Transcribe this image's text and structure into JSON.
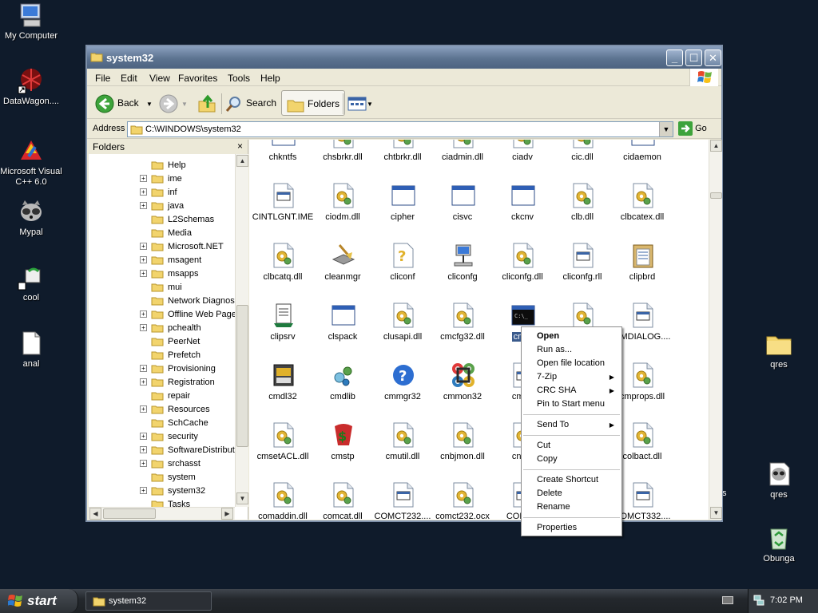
{
  "desktop": {
    "left_icons": [
      {
        "label": "My Computer",
        "icon": "my-computer-icon"
      },
      {
        "label": "DataWagon....",
        "icon": "datawagon-shortcut-icon"
      },
      {
        "label": "Microsoft Visual C++ 6.0",
        "icon": "visual-cpp-icon"
      },
      {
        "label": "Mypal",
        "icon": "mypal-browser-icon"
      },
      {
        "label": "cool",
        "icon": "cool-shortcut-icon"
      },
      {
        "label": "anal",
        "icon": "document-icon"
      }
    ],
    "right_icons": [
      {
        "label": "qres",
        "icon": "folder-icon"
      },
      {
        "label": "qres",
        "icon": "raccoon-app-icon"
      },
      {
        "label": "Obunga",
        "icon": "recycle-bin-icon"
      }
    ],
    "partial_label": "s"
  },
  "window": {
    "title": "system32",
    "menu": [
      "File",
      "Edit",
      "View",
      "Favorites",
      "Tools",
      "Help"
    ],
    "toolbar": {
      "back_label": "Back",
      "search_label": "Search",
      "folders_label": "Folders"
    },
    "address": {
      "label": "Address",
      "value": "C:\\WINDOWS\\system32",
      "go_label": "Go"
    }
  },
  "folders_pane": {
    "title": "Folders",
    "close_glyph": "×",
    "tree": [
      {
        "name": "Help",
        "expandable": false
      },
      {
        "name": "ime",
        "expandable": true
      },
      {
        "name": "inf",
        "expandable": true
      },
      {
        "name": "java",
        "expandable": true
      },
      {
        "name": "L2Schemas",
        "expandable": false
      },
      {
        "name": "Media",
        "expandable": false
      },
      {
        "name": "Microsoft.NET",
        "expandable": true
      },
      {
        "name": "msagent",
        "expandable": true
      },
      {
        "name": "msapps",
        "expandable": true
      },
      {
        "name": "mui",
        "expandable": false
      },
      {
        "name": "Network Diagnost",
        "expandable": false
      },
      {
        "name": "Offline Web Page",
        "expandable": true
      },
      {
        "name": "pchealth",
        "expandable": true
      },
      {
        "name": "PeerNet",
        "expandable": false
      },
      {
        "name": "Prefetch",
        "expandable": false
      },
      {
        "name": "Provisioning",
        "expandable": true
      },
      {
        "name": "Registration",
        "expandable": true
      },
      {
        "name": "repair",
        "expandable": false
      },
      {
        "name": "Resources",
        "expandable": true
      },
      {
        "name": "SchCache",
        "expandable": false
      },
      {
        "name": "security",
        "expandable": true
      },
      {
        "name": "SoftwareDistribut",
        "expandable": true
      },
      {
        "name": "srchasst",
        "expandable": true
      },
      {
        "name": "system",
        "expandable": false
      },
      {
        "name": "system32",
        "expandable": true
      },
      {
        "name": "Tasks",
        "expandable": false
      }
    ]
  },
  "files": [
    {
      "name": "chkntfs",
      "icon": "console-app-icon"
    },
    {
      "name": "chsbrkr.dll",
      "icon": "dll-gear-icon"
    },
    {
      "name": "chtbrkr.dll",
      "icon": "dll-gear-icon"
    },
    {
      "name": "ciadmin.dll",
      "icon": "dll-gear-icon"
    },
    {
      "name": "ciadv",
      "icon": "dll-gear-icon"
    },
    {
      "name": "cic.dll",
      "icon": "dll-gear-icon"
    },
    {
      "name": "cidaemon",
      "icon": "console-app-icon"
    },
    {
      "name": "CINTLGNT.IME",
      "icon": "sys-file-icon"
    },
    {
      "name": "ciodm.dll",
      "icon": "dll-gear-icon"
    },
    {
      "name": "cipher",
      "icon": "window-app-icon"
    },
    {
      "name": "cisvc",
      "icon": "window-app-icon"
    },
    {
      "name": "ckcnv",
      "icon": "window-app-icon"
    },
    {
      "name": "clb.dll",
      "icon": "dll-gear-icon"
    },
    {
      "name": "clbcatex.dll",
      "icon": "dll-gear-icon"
    },
    {
      "name": "clbcatq.dll",
      "icon": "dll-gear-icon"
    },
    {
      "name": "cleanmgr",
      "icon": "disk-cleanup-icon"
    },
    {
      "name": "cliconf",
      "icon": "help-file-icon"
    },
    {
      "name": "cliconfg",
      "icon": "network-computer-icon"
    },
    {
      "name": "cliconfg.dll",
      "icon": "dll-gear-icon"
    },
    {
      "name": "cliconfg.rll",
      "icon": "sys-file-icon"
    },
    {
      "name": "clipbrd",
      "icon": "clipboard-icon"
    },
    {
      "name": "clipsrv",
      "icon": "clipboard-server-icon"
    },
    {
      "name": "clspack",
      "icon": "window-app-icon"
    },
    {
      "name": "clusapi.dll",
      "icon": "dll-gear-icon"
    },
    {
      "name": "cmcfg32.dll",
      "icon": "dll-gear-icon"
    },
    {
      "name": "cmd",
      "icon": "command-prompt-icon"
    },
    {
      "name": "cmdial32.dll",
      "icon": "dll-gear-icon"
    },
    {
      "name": "CMDIALOG....",
      "icon": "sys-file-icon"
    },
    {
      "name": "cmdl32",
      "icon": "phonebook-icon"
    },
    {
      "name": "cmdlib",
      "icon": "gears-icon"
    },
    {
      "name": "cmmgr32",
      "icon": "help-circle-icon"
    },
    {
      "name": "cmmon32",
      "icon": "command-key-icon"
    },
    {
      "name": "cmos",
      "icon": "sys-file-icon"
    },
    {
      "name": "",
      "icon": "dll-gear-icon"
    },
    {
      "name": "cmprops.dll",
      "icon": "dll-gear-icon"
    },
    {
      "name": "cmsetACL.dll",
      "icon": "dll-gear-icon"
    },
    {
      "name": "cmstp",
      "icon": "cmstp-icon"
    },
    {
      "name": "cmutil.dll",
      "icon": "dll-gear-icon"
    },
    {
      "name": "cnbjmon.dll",
      "icon": "dll-gear-icon"
    },
    {
      "name": "cnetc",
      "icon": "dll-gear-icon"
    },
    {
      "name": "",
      "icon": "dll-gear-icon"
    },
    {
      "name": "colbact.dll",
      "icon": "dll-gear-icon"
    },
    {
      "name": "comaddin.dll",
      "icon": "dll-gear-icon"
    },
    {
      "name": "comcat.dll",
      "icon": "dll-gear-icon"
    },
    {
      "name": "COMCT232....",
      "icon": "sys-file-icon"
    },
    {
      "name": "comct232.ocx",
      "icon": "dll-gear-icon"
    },
    {
      "name": "COMCT",
      "icon": "sys-file-icon"
    },
    {
      "name": "",
      "icon": "dll-gear-icon"
    },
    {
      "name": "COMCT332....",
      "icon": "sys-file-icon"
    }
  ],
  "context_menu": {
    "items": [
      {
        "label": "Open",
        "bold": true
      },
      {
        "label": "Run as..."
      },
      {
        "label": "Open file location"
      },
      {
        "label": "7-Zip",
        "submenu": true
      },
      {
        "label": "CRC SHA",
        "submenu": true
      },
      {
        "label": "Pin to Start menu"
      },
      {
        "separator": true
      },
      {
        "label": "Send To",
        "submenu": true
      },
      {
        "separator": true
      },
      {
        "label": "Cut"
      },
      {
        "label": "Copy"
      },
      {
        "separator": true
      },
      {
        "label": "Create Shortcut"
      },
      {
        "label": "Delete"
      },
      {
        "label": "Rename"
      },
      {
        "separator": true
      },
      {
        "label": "Properties"
      }
    ]
  },
  "taskbar": {
    "start_label": "start",
    "task_label": "system32",
    "clock": "7:02 PM"
  },
  "colors": {
    "desktop_bg": "#0f1b2b",
    "title_gradient": "#5c7390",
    "selection": "#3a5a8c"
  }
}
